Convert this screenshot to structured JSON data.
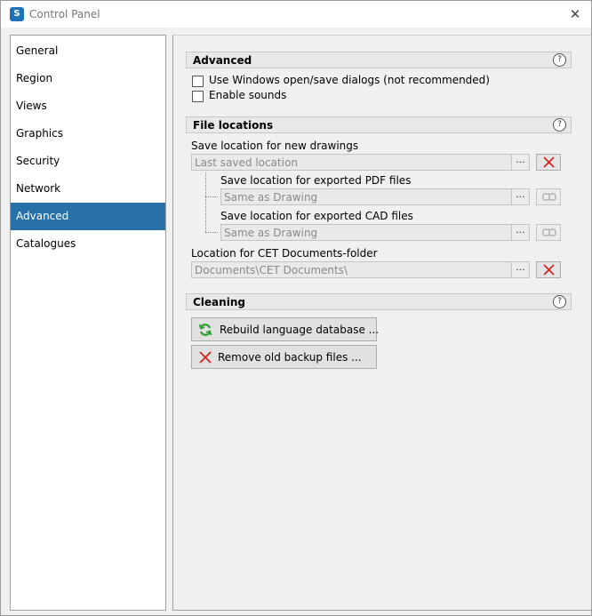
{
  "window": {
    "title": "Control Panel",
    "close_label": "✕",
    "app_icon_letter": "S"
  },
  "sidebar": {
    "items": [
      {
        "label": "General",
        "active": false
      },
      {
        "label": "Region",
        "active": false
      },
      {
        "label": "Views",
        "active": false
      },
      {
        "label": "Graphics",
        "active": false
      },
      {
        "label": "Security",
        "active": false
      },
      {
        "label": "Network",
        "active": false
      },
      {
        "label": "Advanced",
        "active": true
      },
      {
        "label": "Catalogues",
        "active": false
      }
    ]
  },
  "advanced": {
    "title": "Advanced",
    "help": "?",
    "options": [
      {
        "label": "Use Windows open/save dialogs (not recommended)",
        "checked": false
      },
      {
        "label": "Enable sounds",
        "checked": false
      }
    ]
  },
  "file_locations": {
    "title": "File locations",
    "help": "?",
    "browse_label": "...",
    "new_drawings": {
      "label": "Save location for new drawings",
      "value": "Last saved location"
    },
    "pdf": {
      "label": "Save location for exported PDF files",
      "value": "Same as Drawing"
    },
    "cad": {
      "label": "Save location for exported CAD files",
      "value": "Same as Drawing"
    },
    "documents": {
      "label": "Location for CET Documents-folder",
      "value": "Documents\\CET Documents\\"
    }
  },
  "cleaning": {
    "title": "Cleaning",
    "help": "?",
    "rebuild_label": "Rebuild language database ...",
    "remove_label": "Remove old backup files ..."
  },
  "colors": {
    "accent": "#2770a8",
    "delete_red": "#d42020",
    "refresh_green": "#2e9e2e"
  }
}
